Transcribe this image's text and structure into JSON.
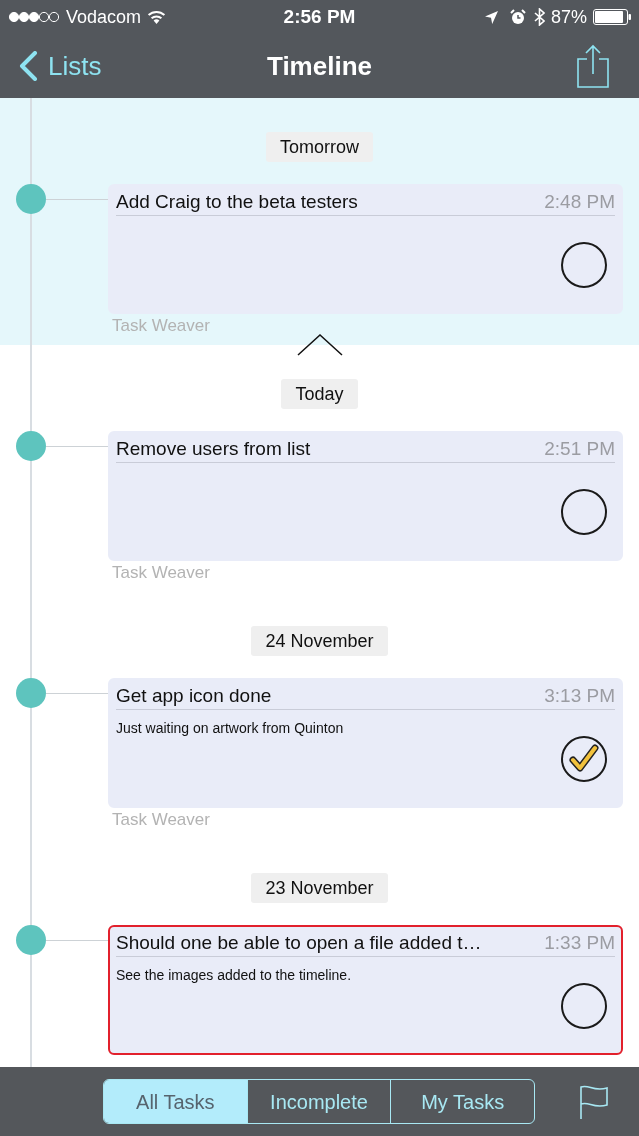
{
  "status_bar": {
    "carrier": "Vodacom",
    "time": "2:56 PM",
    "battery": "87%"
  },
  "nav_bar": {
    "back": "Lists",
    "title": "Timeline"
  },
  "sections": [
    {
      "label": "Tomorrow",
      "highlighted": true,
      "tasks": [
        {
          "title": "Add Craig to the beta testers",
          "time": "2:48 PM",
          "checked": false,
          "selected": false,
          "list": "Task Weaver"
        }
      ]
    },
    {
      "label": "Today",
      "highlighted": false,
      "tasks": [
        {
          "title": "Remove users from list",
          "time": "2:51 PM",
          "checked": false,
          "selected": false,
          "list": "Task Weaver"
        }
      ]
    },
    {
      "label": "24 November",
      "highlighted": false,
      "tasks": [
        {
          "title": "Get app icon done",
          "time": "3:13 PM",
          "note": "Just waiting on artwork from Quinton",
          "checked": true,
          "selected": false,
          "list": "Task Weaver"
        }
      ]
    },
    {
      "label": "23 November",
      "highlighted": false,
      "tasks": [
        {
          "title": "Should one be able to open a file added t…",
          "time": "1:33 PM",
          "note": "See the images added to the timeline.",
          "checked": false,
          "selected": true
        }
      ]
    }
  ],
  "filter_tabs": [
    {
      "label": "All Tasks",
      "selected": true
    },
    {
      "label": "Incomplete",
      "selected": false
    },
    {
      "label": "My Tasks",
      "selected": false
    }
  ]
}
